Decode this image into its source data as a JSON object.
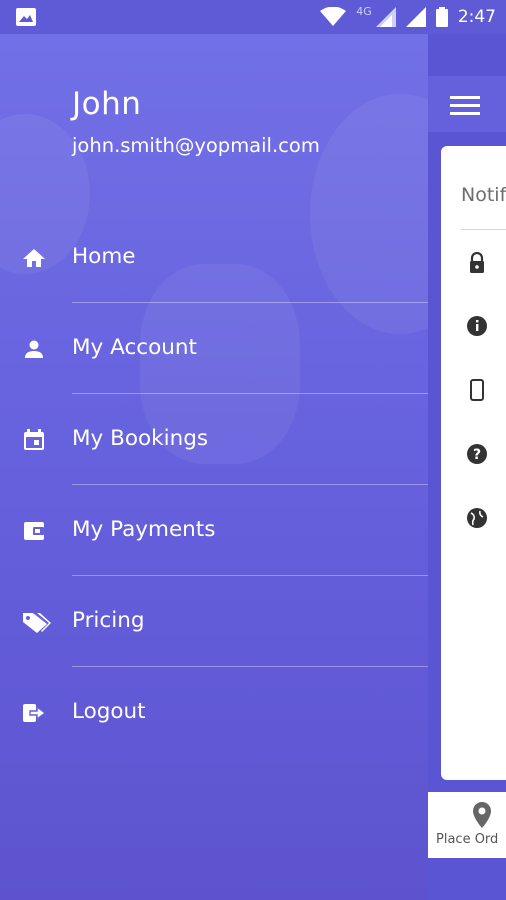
{
  "status_bar": {
    "network": "4G",
    "time": "2:47"
  },
  "drawer": {
    "user_name": "John",
    "user_email": "john.smith@yopmail.com",
    "items": [
      {
        "label": "Home",
        "icon": "home-icon"
      },
      {
        "label": "My Account",
        "icon": "person-icon"
      },
      {
        "label": "My Bookings",
        "icon": "calendar-icon"
      },
      {
        "label": "My Payments",
        "icon": "wallet-icon"
      },
      {
        "label": "Pricing",
        "icon": "tags-icon"
      },
      {
        "label": "Logout",
        "icon": "logout-icon"
      }
    ]
  },
  "main": {
    "card_title": "Notif",
    "bottom_nav_label": "Place Ord"
  },
  "colors": {
    "drawer_top": "#7270e6",
    "drawer_bottom": "#5d53cf",
    "accent": "#6561dd"
  }
}
